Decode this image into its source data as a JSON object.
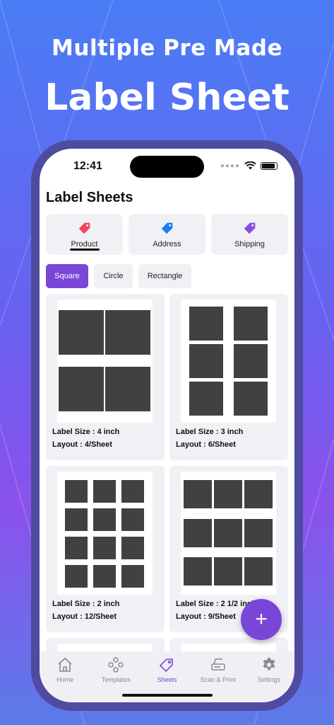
{
  "headline": {
    "subtitle": "Multiple Pre Made",
    "title": "Label Sheet"
  },
  "status": {
    "time": "12:41"
  },
  "page_title": "Label Sheets",
  "categories": [
    {
      "label": "Product",
      "color": "#f0475a",
      "selected": true
    },
    {
      "label": "Address",
      "color": "#1a7df2",
      "selected": false
    },
    {
      "label": "Shipping",
      "color": "#8a4ee3",
      "selected": false
    }
  ],
  "shapes": [
    {
      "label": "Square",
      "selected": true
    },
    {
      "label": "Circle",
      "selected": false
    },
    {
      "label": "Rectangle",
      "selected": false
    }
  ],
  "sheets": [
    {
      "size": "Label Size : 4 inch",
      "layout": "Layout : 4/Sheet"
    },
    {
      "size": "Label Size : 3 inch",
      "layout": "Layout : 6/Sheet"
    },
    {
      "size": "Label Size : 2 inch",
      "layout": "Layout : 12/Sheet"
    },
    {
      "size": "Label Size : 2 1/2 inch",
      "layout": "Layout : 9/Sheet"
    }
  ],
  "fab": {
    "label": "+"
  },
  "tabs": [
    {
      "label": "Home",
      "icon": "home-icon",
      "active": false
    },
    {
      "label": "Templates",
      "icon": "templates-icon",
      "active": false
    },
    {
      "label": "Sheets",
      "icon": "tag-icon",
      "active": true
    },
    {
      "label": "Scan & Print",
      "icon": "scanner-icon",
      "active": false
    },
    {
      "label": "Settings",
      "icon": "gear-icon",
      "active": false
    }
  ],
  "colors": {
    "accent": "#7a46d8",
    "cell": "#414141"
  }
}
